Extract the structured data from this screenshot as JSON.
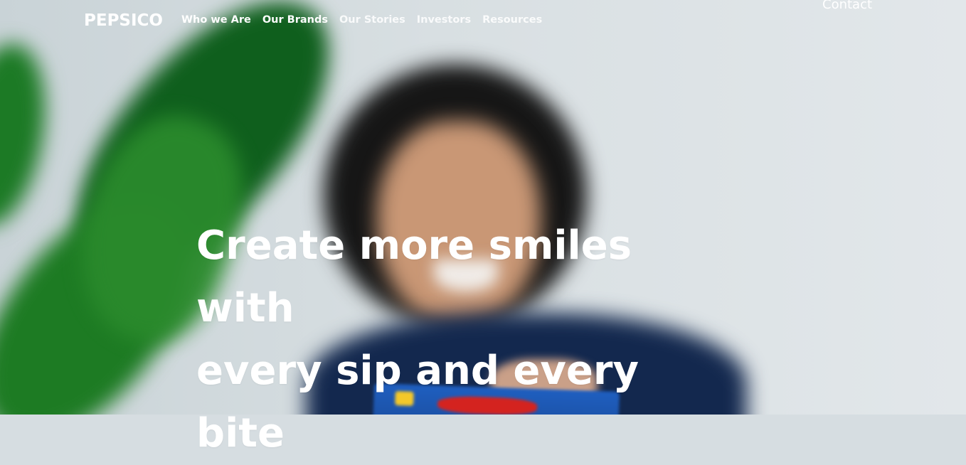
{
  "header": {
    "logo": "PEPSICO",
    "nav": [
      "Who we Are",
      "Our Brands",
      "Our Stories",
      "Investors",
      "Resources"
    ],
    "contact": "Contact"
  },
  "hero": {
    "headline_line1": "Create more smiles with",
    "headline_line2": "every sip and every bite",
    "image_description": ""
  },
  "colors": {
    "text": "#ffffff",
    "leaf_green": "#1d7b23",
    "shirt_navy": "#13284e",
    "background": "#d6dde1"
  }
}
